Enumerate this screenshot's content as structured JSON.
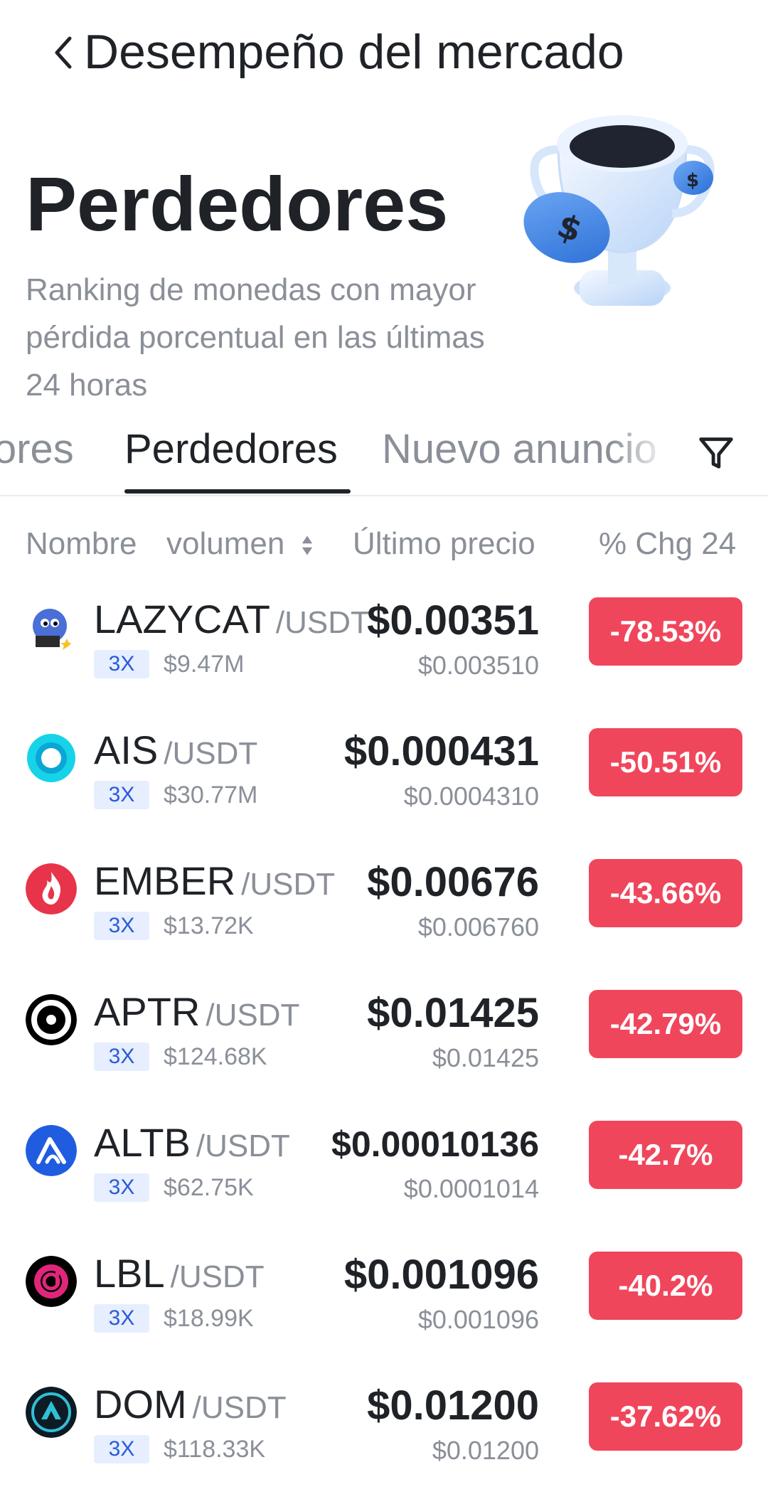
{
  "header": {
    "title": "Desempeño del mercado",
    "back_icon": "chevron-left-icon"
  },
  "hero": {
    "title": "Perdedores",
    "description": "Ranking de monedas con mayor pérdida porcentual en las últimas 24 horas",
    "illustration": "trophy-icon"
  },
  "tabs": [
    {
      "label": "lores",
      "active": false
    },
    {
      "label": "Perdedores",
      "active": true
    },
    {
      "label": "Nuevo anuncio",
      "active": false
    }
  ],
  "filter_icon": "filter-icon",
  "columns": {
    "name": "Nombre",
    "volume": "volumen",
    "last_price": "Último precio",
    "change": "% Chg 24"
  },
  "colors": {
    "negative": "#f0465c",
    "leverage_bg": "#e6eeff",
    "leverage_text": "#2a5bd7"
  },
  "rows": [
    {
      "symbol": "LAZYCAT",
      "quote": "/USDT",
      "leverage": "3X",
      "volume": "$9.47M",
      "price": "$0.00351",
      "subprice": "$0.003510",
      "change": "-78.53%",
      "icon": "lazycat-coin-icon"
    },
    {
      "symbol": "AIS",
      "quote": "/USDT",
      "leverage": "3X",
      "volume": "$30.77M",
      "price": "$0.000431",
      "subprice": "$0.0004310",
      "change": "-50.51%",
      "icon": "ais-coin-icon"
    },
    {
      "symbol": "EMBER",
      "quote": "/USDT",
      "leverage": "3X",
      "volume": "$13.72K",
      "price": "$0.00676",
      "subprice": "$0.006760",
      "change": "-43.66%",
      "icon": "ember-coin-icon"
    },
    {
      "symbol": "APTR",
      "quote": "/USDT",
      "leverage": "3X",
      "volume": "$124.68K",
      "price": "$0.01425",
      "subprice": "$0.01425",
      "change": "-42.79%",
      "icon": "aptr-coin-icon"
    },
    {
      "symbol": "ALTB",
      "quote": "/USDT",
      "leverage": "3X",
      "volume": "$62.75K",
      "price": "$0.00010136",
      "subprice": "$0.0001014",
      "change": "-42.7%",
      "icon": "altb-coin-icon"
    },
    {
      "symbol": "LBL",
      "quote": "/USDT",
      "leverage": "3X",
      "volume": "$18.99K",
      "price": "$0.001096",
      "subprice": "$0.001096",
      "change": "-40.2%",
      "icon": "lbl-coin-icon"
    },
    {
      "symbol": "DOM",
      "quote": "/USDT",
      "leverage": "3X",
      "volume": "$118.33K",
      "price": "$0.01200",
      "subprice": "$0.01200",
      "change": "-37.62%",
      "icon": "dom-coin-icon"
    }
  ]
}
